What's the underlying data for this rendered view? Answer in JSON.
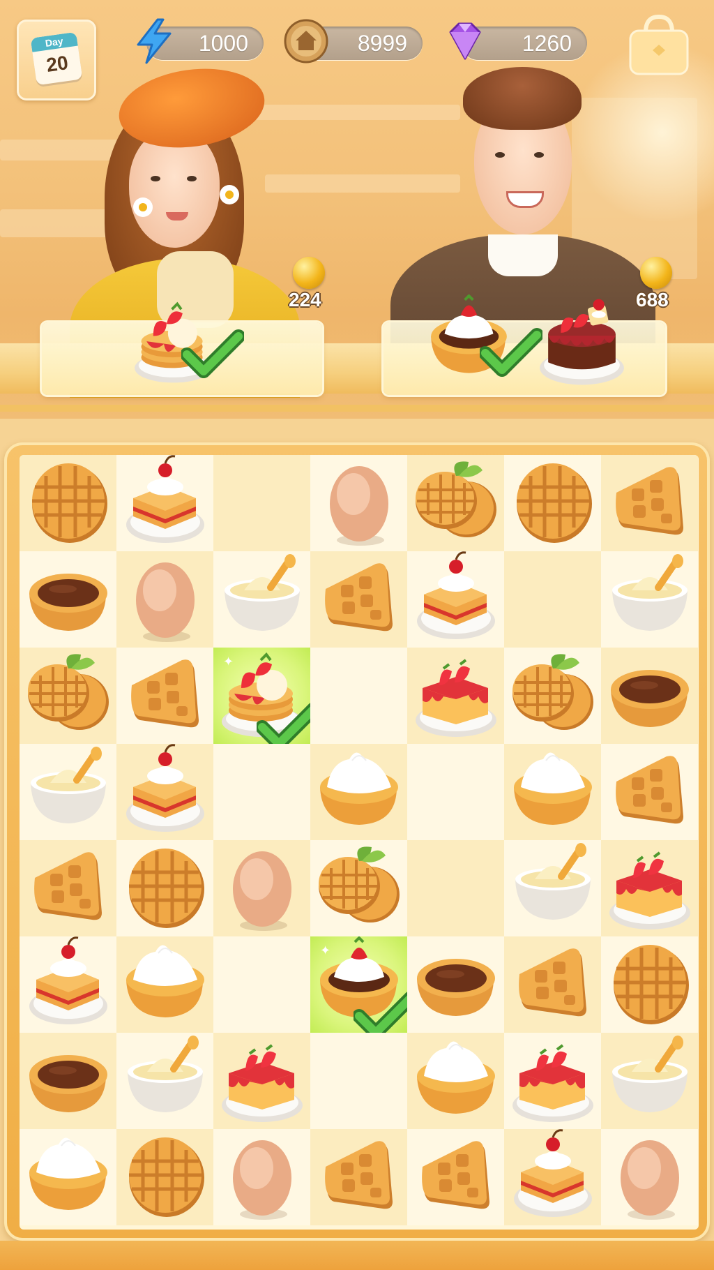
{
  "hud": {
    "day_label": "Day",
    "day_number": "20",
    "energy": "1000",
    "coins": "8999",
    "gems": "1260",
    "icons": [
      "calendar-icon",
      "lightning-icon",
      "house-coin-icon",
      "gem-icon",
      "bag-icon"
    ]
  },
  "customers": [
    {
      "name": "customer-girl",
      "coin_reward": "224",
      "order": [
        {
          "item": "strawberry-pancake",
          "done": true
        }
      ]
    },
    {
      "name": "customer-boy",
      "coin_reward": "688",
      "order": [
        {
          "item": "cream-tart",
          "done": true
        },
        {
          "item": "chocolate-strawberry-cake",
          "done": false
        }
      ]
    }
  ],
  "board": {
    "cols": 7,
    "rows": 8,
    "grid": [
      [
        "waffle-round",
        "layer-cake",
        "",
        "egg",
        "waffle-leaf",
        "waffle-round",
        "waffle-triangle"
      ],
      [
        "choco-tart",
        "egg",
        "custard-bowl",
        "waffle-triangle",
        "layer-cake",
        "",
        "custard-bowl"
      ],
      [
        "waffle-leaf",
        "waffle-triangle",
        "strawberry-pancake*",
        "",
        "strawberry-cheesecake",
        "waffle-leaf",
        "choco-tart"
      ],
      [
        "custard-bowl",
        "layer-cake",
        "",
        "cream-tart",
        "",
        "cream-tart",
        "waffle-triangle"
      ],
      [
        "waffle-triangle",
        "waffle-round",
        "egg",
        "waffle-leaf",
        "",
        "custard-bowl",
        "strawberry-cheesecake"
      ],
      [
        "layer-cake",
        "cream-tart",
        "",
        "cream-tart-strawberry*",
        "choco-tart",
        "waffle-triangle",
        "waffle-round"
      ],
      [
        "choco-tart",
        "custard-bowl",
        "strawberry-cheesecake",
        "",
        "cream-tart",
        "strawberry-cheesecake",
        "custard-bowl"
      ],
      [
        "cream-tart",
        "waffle-round",
        "egg",
        "waffle-triangle",
        "waffle-triangle",
        "layer-cake",
        "egg"
      ]
    ]
  }
}
